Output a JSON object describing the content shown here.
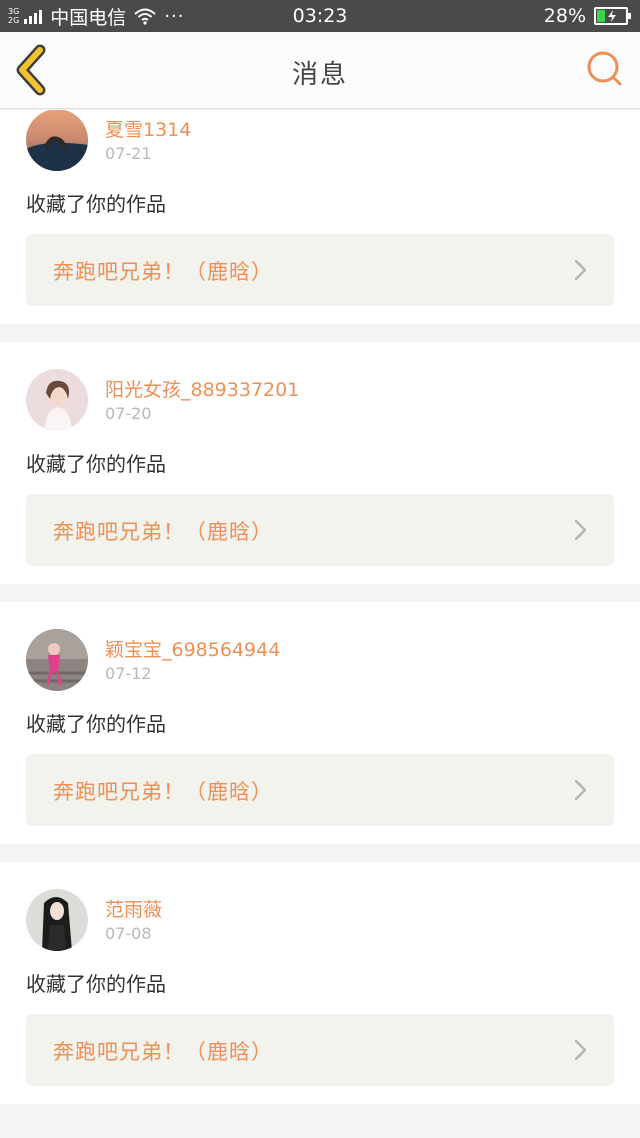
{
  "status_bar": {
    "network_top": "3G",
    "network_bottom": "2G",
    "carrier": "中国电信",
    "more": "···",
    "time": "03:23",
    "battery_percent": "28%",
    "battery_level": 0.28,
    "icons": [
      "signal-icon",
      "wifi-icon",
      "battery-icon"
    ]
  },
  "header": {
    "title": "消息",
    "back_icon": "chevron-left-icon",
    "search_icon": "search-icon",
    "accent": "#ef8f55",
    "back_color": "#f2c230"
  },
  "messages": [
    {
      "username": "夏雪1314",
      "date": "07-21",
      "action": "收藏了你的作品",
      "work": "奔跑吧兄弟！（鹿晗）"
    },
    {
      "username": "阳光女孩_889337201",
      "date": "07-20",
      "action": "收藏了你的作品",
      "work": "奔跑吧兄弟！（鹿晗）"
    },
    {
      "username": "颖宝宝_698564944",
      "date": "07-12",
      "action": "收藏了你的作品",
      "work": "奔跑吧兄弟！（鹿晗）"
    },
    {
      "username": "范雨薇",
      "date": "07-08",
      "action": "收藏了你的作品",
      "work": "奔跑吧兄弟！（鹿晗）"
    }
  ]
}
